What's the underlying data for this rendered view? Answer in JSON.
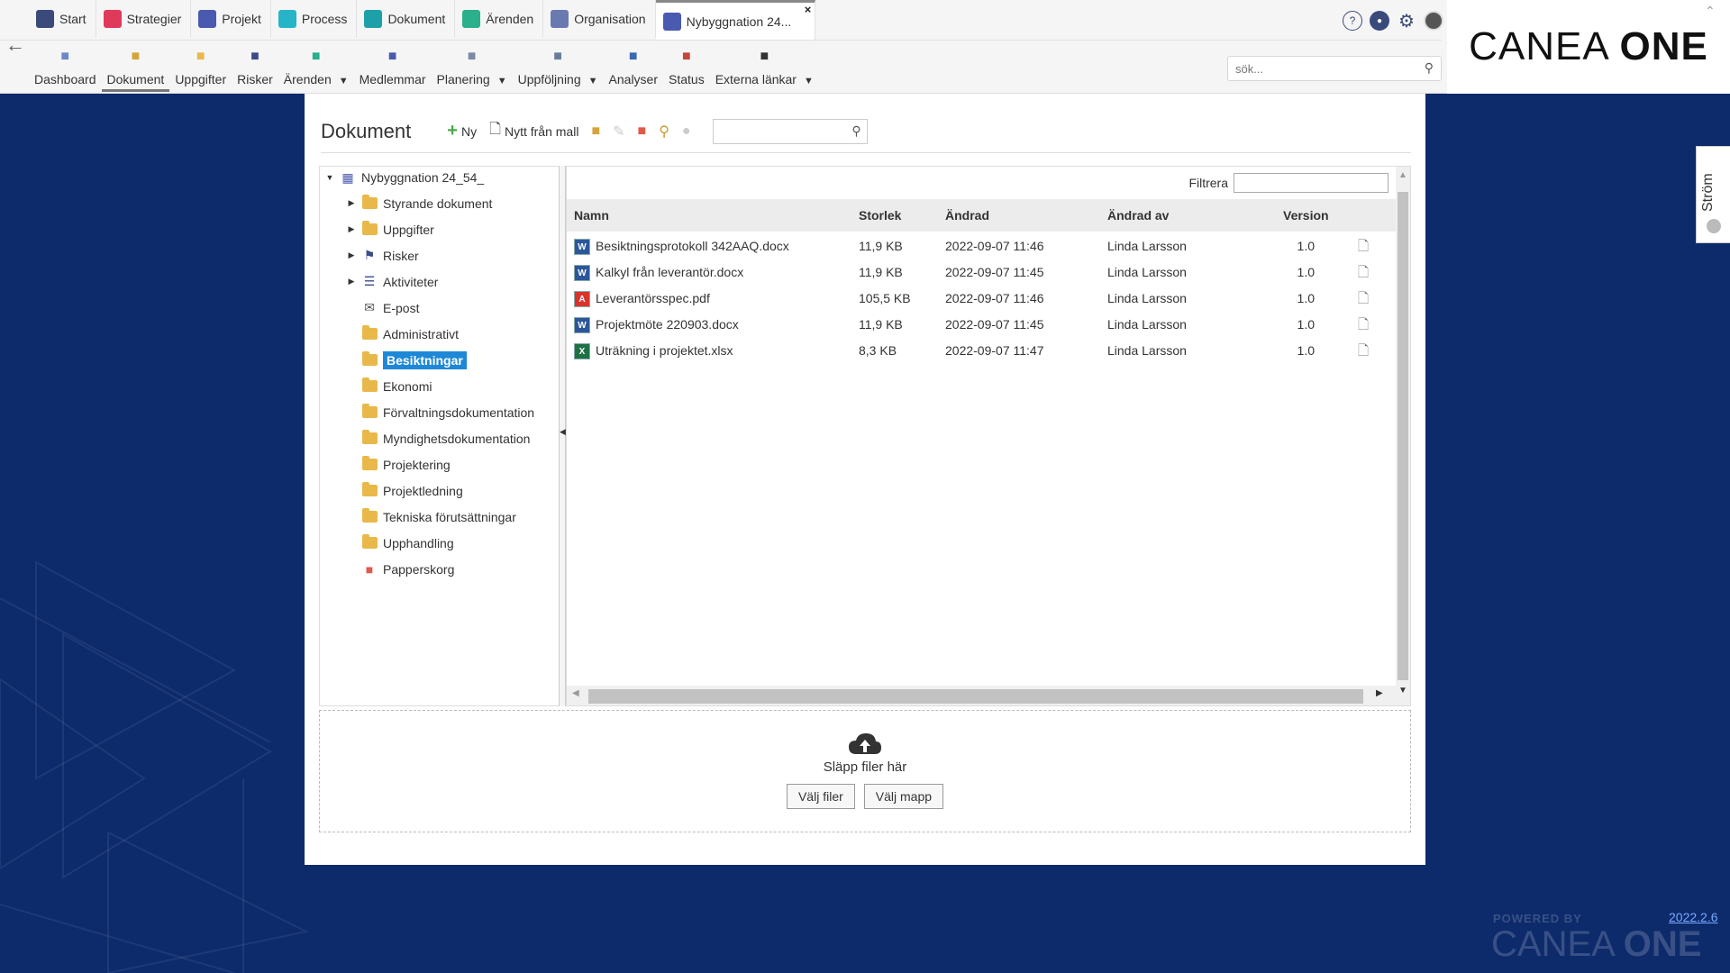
{
  "tabs": [
    {
      "label": "Start",
      "icon": "home-icon",
      "color": "#3a4a7a"
    },
    {
      "label": "Strategier",
      "icon": "strategy-icon",
      "color": "#e03a5a"
    },
    {
      "label": "Projekt",
      "icon": "project-icon",
      "color": "#4a5ab0"
    },
    {
      "label": "Process",
      "icon": "process-icon",
      "color": "#28b4c8"
    },
    {
      "label": "Dokument",
      "icon": "document-icon",
      "color": "#1ea0a8"
    },
    {
      "label": "Ärenden",
      "icon": "case-icon",
      "color": "#2ab08a"
    },
    {
      "label": "Organisation",
      "icon": "organisation-icon",
      "color": "#6a7ab0"
    },
    {
      "label": "Nybyggnation 24...",
      "icon": "project-grid-icon",
      "color": "#4a5ab0",
      "active": true
    }
  ],
  "toolbar": [
    {
      "label": "Dashboard",
      "icon": "dashboard-icon",
      "caret": false
    },
    {
      "label": "Dokument",
      "icon": "folder-icon",
      "caret": false,
      "active": true
    },
    {
      "label": "Uppgifter",
      "icon": "tasks-icon",
      "caret": false
    },
    {
      "label": "Risker",
      "icon": "flag-icon",
      "caret": false
    },
    {
      "label": "Ärenden",
      "icon": "case-icon",
      "caret": true
    },
    {
      "label": "Medlemmar",
      "icon": "members-icon",
      "caret": false
    },
    {
      "label": "Planering",
      "icon": "planning-icon",
      "caret": true
    },
    {
      "label": "Uppföljning",
      "icon": "followup-icon",
      "caret": true
    },
    {
      "label": "Analyser",
      "icon": "chart-icon",
      "caret": false
    },
    {
      "label": "Status",
      "icon": "traffic-light-icon",
      "caret": false
    },
    {
      "label": "Externa länkar",
      "icon": "external-link-icon",
      "caret": true
    }
  ],
  "global_search": {
    "placeholder": "sök..."
  },
  "brand": {
    "name_light": "CANEA ",
    "name_bold": "ONE"
  },
  "document": {
    "title": "Dokument",
    "actions": {
      "new_label": "Ny",
      "from_template_label": "Nytt från mall"
    }
  },
  "tree": {
    "root": "Nybyggnation 24_54_",
    "items": [
      {
        "label": "Styrande dokument",
        "expandable": true,
        "icon": "folder-open-icon"
      },
      {
        "label": "Uppgifter",
        "expandable": true,
        "icon": "tasks-folder-icon"
      },
      {
        "label": "Risker",
        "expandable": true,
        "icon": "flag-icon"
      },
      {
        "label": "Aktiviteter",
        "expandable": true,
        "icon": "activities-icon"
      },
      {
        "label": "E-post",
        "expandable": false,
        "icon": "mail-icon"
      },
      {
        "label": "Administrativt",
        "expandable": false,
        "icon": "folder-icon"
      },
      {
        "label": "Besiktningar",
        "expandable": false,
        "icon": "folder-icon",
        "selected": true
      },
      {
        "label": "Ekonomi",
        "expandable": false,
        "icon": "folder-icon"
      },
      {
        "label": "Förvaltningsdokumentation",
        "expandable": false,
        "icon": "folder-icon"
      },
      {
        "label": "Myndighetsdokumentation",
        "expandable": false,
        "icon": "folder-icon"
      },
      {
        "label": "Projektering",
        "expandable": false,
        "icon": "folder-icon"
      },
      {
        "label": "Projektledning",
        "expandable": false,
        "icon": "folder-icon"
      },
      {
        "label": "Tekniska förutsättningar",
        "expandable": false,
        "icon": "folder-icon"
      },
      {
        "label": "Upphandling",
        "expandable": false,
        "icon": "folder-icon"
      },
      {
        "label": "Papperskorg",
        "expandable": false,
        "icon": "trash-icon"
      }
    ]
  },
  "list": {
    "filter_label": "Filtrera",
    "columns": {
      "name": "Namn",
      "size": "Storlek",
      "changed": "Ändrad",
      "changed_by": "Ändrad av",
      "version": "Version"
    },
    "rows": [
      {
        "name": "Besiktningsprotokoll 342AAQ.docx",
        "size": "11,9 KB",
        "changed": "2022-09-07 11:46",
        "changed_by": "Linda Larsson",
        "version": "1.0",
        "type": "word"
      },
      {
        "name": "Kalkyl från leverantör.docx",
        "size": "11,9 KB",
        "changed": "2022-09-07 11:45",
        "changed_by": "Linda Larsson",
        "version": "1.0",
        "type": "word"
      },
      {
        "name": "Leverantörsspec.pdf",
        "size": "105,5 KB",
        "changed": "2022-09-07 11:46",
        "changed_by": "Linda Larsson",
        "version": "1.0",
        "type": "pdf"
      },
      {
        "name": "Projektmöte 220903.docx",
        "size": "11,9 KB",
        "changed": "2022-09-07 11:45",
        "changed_by": "Linda Larsson",
        "version": "1.0",
        "type": "word"
      },
      {
        "name": "Uträkning i projektet.xlsx",
        "size": "8,3 KB",
        "changed": "2022-09-07 11:47",
        "changed_by": "Linda Larsson",
        "version": "1.0",
        "type": "excel"
      }
    ]
  },
  "dropzone": {
    "text": "Släpp filer här",
    "choose_files": "Välj filer",
    "choose_folder": "Välj mapp"
  },
  "side_tab": {
    "label": "Ström"
  },
  "footer": {
    "powered_by": "POWERED BY",
    "brand_light": "CANEA ",
    "brand_bold": "ONE",
    "version": "2022.2.6"
  },
  "colors": {
    "selected": "#1e88d6",
    "background": "#0d2a6b",
    "word": "#2b579a",
    "pdf": "#d9342b",
    "excel": "#1e7145"
  }
}
